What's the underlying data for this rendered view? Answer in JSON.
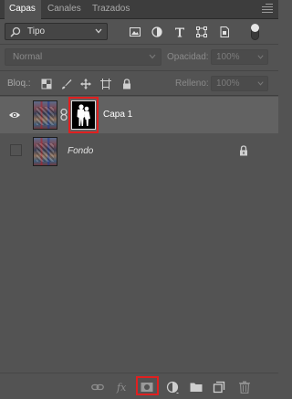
{
  "tabs": [
    {
      "label": "Capas",
      "active": true
    },
    {
      "label": "Canales",
      "active": false
    },
    {
      "label": "Trazados",
      "active": false
    }
  ],
  "filter": {
    "kind_label": "Tipo",
    "icons": [
      "pixel-filter-icon",
      "adjustment-filter-icon",
      "type-filter-icon",
      "shape-filter-icon",
      "smart-object-filter-icon"
    ]
  },
  "blend": {
    "mode": "Normal",
    "opacity_label": "Opacidad:",
    "opacity_value": "100%"
  },
  "lock": {
    "label": "Bloq.:",
    "fill_label": "Relleno:",
    "fill_value": "100%"
  },
  "layers": [
    {
      "name": "Capa 1",
      "visible": true,
      "selected": true,
      "has_mask": true
    },
    {
      "name": "Fondo",
      "visible": false,
      "selected": false,
      "locked": true
    }
  ],
  "colors": {
    "panel_bg": "#535353",
    "selected_row": "#626262",
    "highlight": "#e02020"
  }
}
